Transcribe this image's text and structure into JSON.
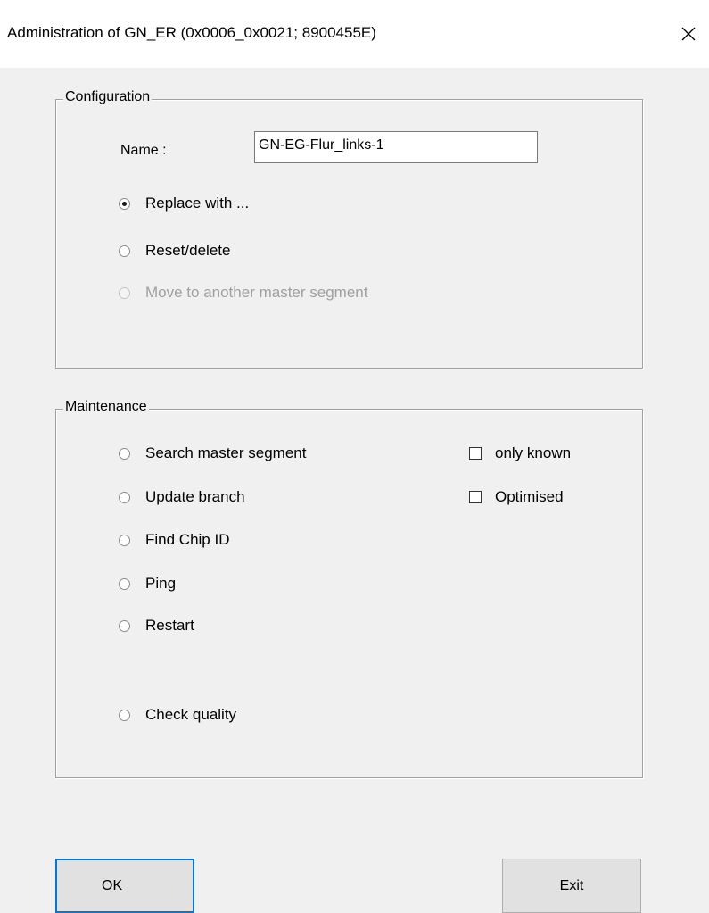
{
  "window": {
    "title": "Administration of GN_ER (0x0006_0x0021; 8900455E)",
    "close_icon": "close-x-icon"
  },
  "configuration": {
    "legend": "Configuration",
    "name_label": "Name :",
    "name_value": "GN-EG-Flur_links-1",
    "options": [
      {
        "label": "Replace with ...",
        "checked": true,
        "enabled": true
      },
      {
        "label": "Reset/delete",
        "checked": false,
        "enabled": true
      },
      {
        "label": "Move to another master segment",
        "checked": false,
        "enabled": false
      }
    ]
  },
  "maintenance": {
    "legend": "Maintenance",
    "options": [
      {
        "label": "Search master segment",
        "checked": false
      },
      {
        "label": "Update branch",
        "checked": false
      },
      {
        "label": "Find Chip ID",
        "checked": false
      },
      {
        "label": "Ping",
        "checked": false
      },
      {
        "label": "Restart",
        "checked": false
      },
      {
        "label": "Check quality",
        "checked": false
      }
    ],
    "checkboxes": [
      {
        "label": "only known",
        "checked": false
      },
      {
        "label": "Optimised",
        "checked": false
      }
    ]
  },
  "buttons": {
    "ok_label": "OK",
    "exit_label": "Exit"
  },
  "colors": {
    "dialog_bg": "#f0f0f0",
    "title_bg": "#ffffff",
    "focus_border": "#0078d7",
    "disabled_text": "#a0a0a0"
  }
}
